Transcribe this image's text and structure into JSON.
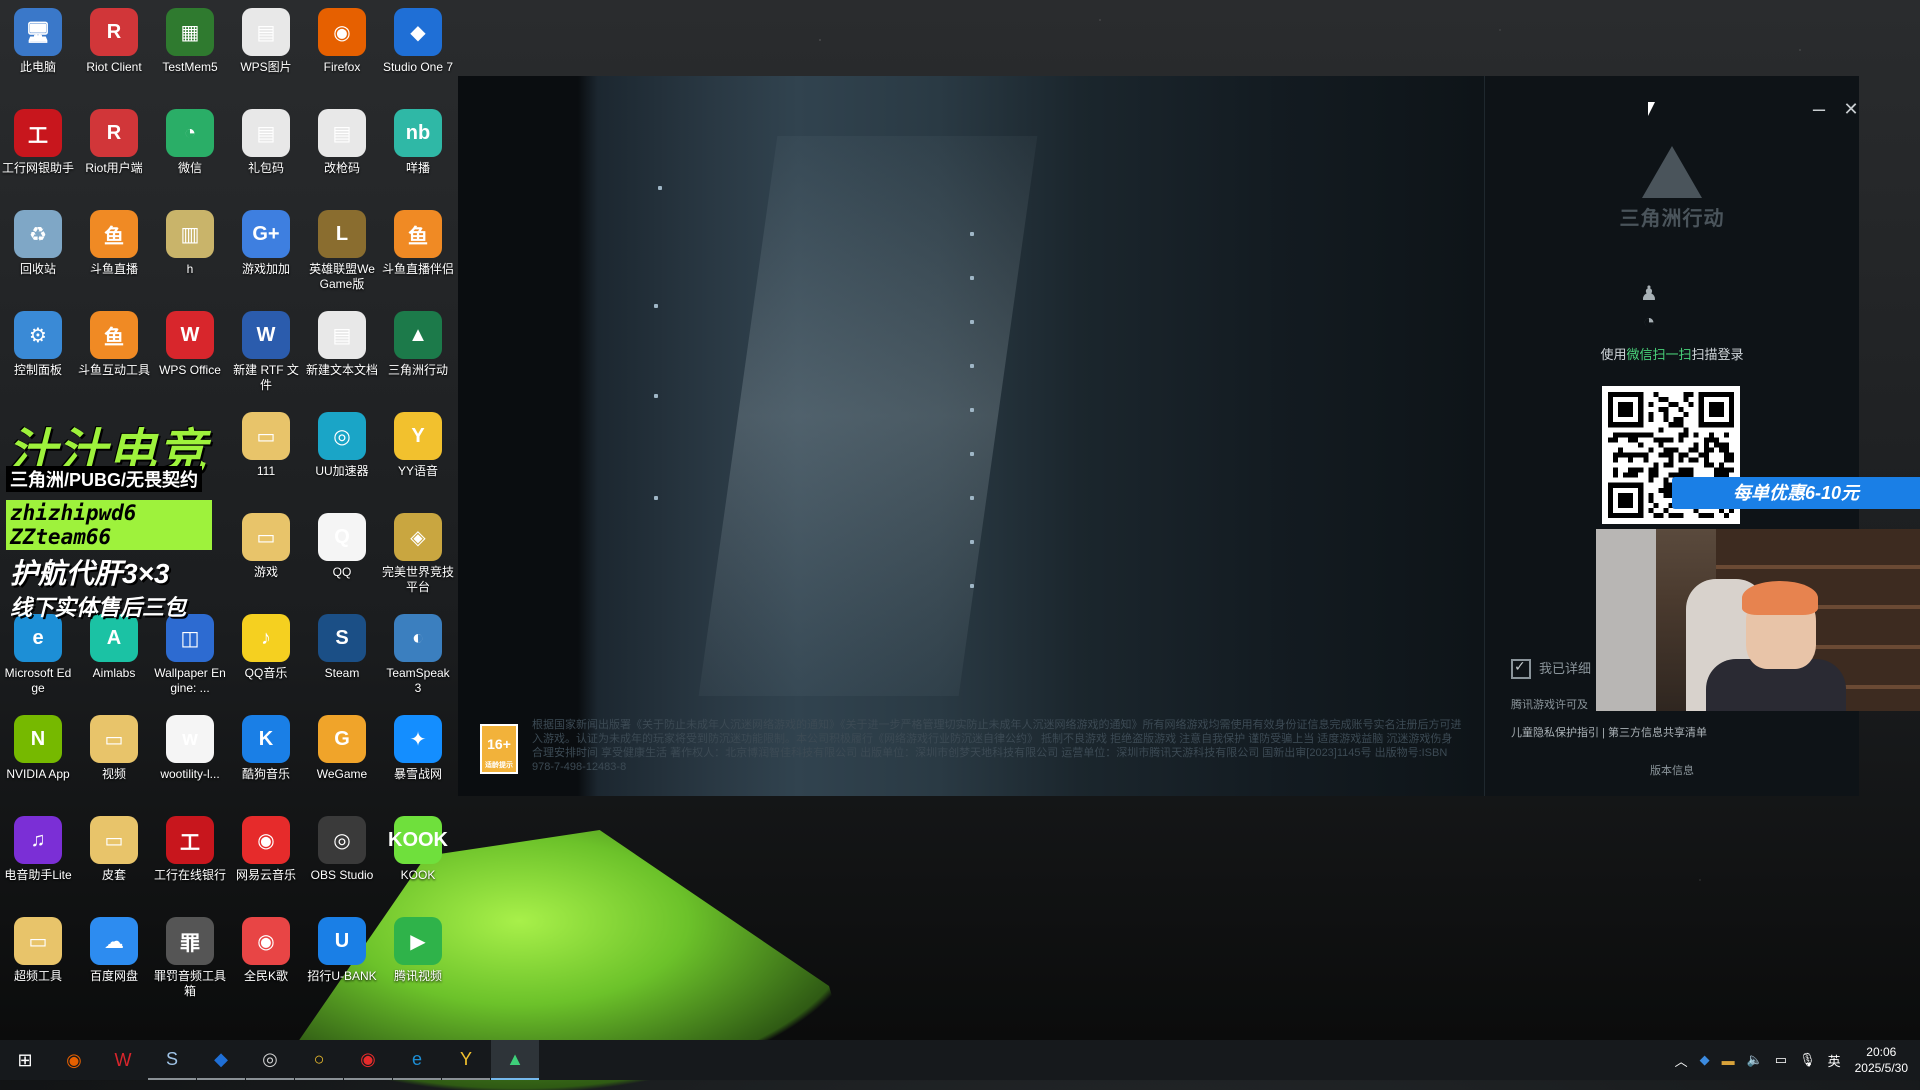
{
  "desktop_icons": [
    {
      "label": "此电脑",
      "glyph": "🖥",
      "color": "#3a78c9"
    },
    {
      "label": "Riot Client",
      "glyph": "R",
      "color": "#d13639"
    },
    {
      "label": "TestMem5",
      "glyph": "▦",
      "color": "#2f7a2f"
    },
    {
      "label": "WPS图片",
      "glyph": "▤",
      "color": "#e8e8e8"
    },
    {
      "label": "Firefox",
      "glyph": "◉",
      "color": "#e66000"
    },
    {
      "label": "Studio One 7",
      "glyph": "◆",
      "color": "#1f6fd6"
    },
    {
      "label": "工行网银助手",
      "glyph": "工",
      "color": "#c8161d"
    },
    {
      "label": "Riot用户端",
      "glyph": "R",
      "color": "#d13639"
    },
    {
      "label": "微信",
      "glyph": "◔",
      "color": "#2aae67"
    },
    {
      "label": "礼包码",
      "glyph": "▤",
      "color": "#e8e8e8"
    },
    {
      "label": "改枪码",
      "glyph": "▤",
      "color": "#e8e8e8"
    },
    {
      "label": "咩播",
      "glyph": "nb",
      "color": "#2fb8a6"
    },
    {
      "label": "回收站",
      "glyph": "♻",
      "color": "#7fa7c6"
    },
    {
      "label": "斗鱼直播",
      "glyph": "鱼",
      "color": "#f08a24"
    },
    {
      "label": "h",
      "glyph": "▥",
      "color": "#c9b46a"
    },
    {
      "label": "游戏加加",
      "glyph": "G+",
      "color": "#3e7fe0"
    },
    {
      "label": "英雄联盟WeGame版",
      "glyph": "L",
      "color": "#8a6d2f"
    },
    {
      "label": "斗鱼直播伴侣",
      "glyph": "鱼",
      "color": "#f08a24"
    },
    {
      "label": "控制面板",
      "glyph": "⚙",
      "color": "#3a8ad6"
    },
    {
      "label": "斗鱼互动工具",
      "glyph": "鱼",
      "color": "#f08a24"
    },
    {
      "label": "WPS Office",
      "glyph": "W",
      "color": "#d8262c"
    },
    {
      "label": "新建 RTF 文件",
      "glyph": "W",
      "color": "#2b5cad"
    },
    {
      "label": "新建文本文档",
      "glyph": "▤",
      "color": "#e8e8e8"
    },
    {
      "label": "三角洲行动",
      "glyph": "▲",
      "color": "#1c7a4a"
    },
    {
      "label": "111",
      "glyph": "▭",
      "color": "#e8c46a"
    },
    {
      "label": "UU加速器",
      "glyph": "◎",
      "color": "#1aa5c7"
    },
    {
      "label": "YY语音",
      "glyph": "Y",
      "color": "#f2c12e"
    },
    {
      "label": "游戏",
      "glyph": "▭",
      "color": "#e8c46a"
    },
    {
      "label": "QQ",
      "glyph": "Q",
      "color": "#f5f5f5"
    },
    {
      "label": "完美世界竞技平台",
      "glyph": "◈",
      "color": "#c9a640"
    },
    {
      "label": "Microsoft Edge",
      "glyph": "e",
      "color": "#1d8fd6"
    },
    {
      "label": "Aimlabs",
      "glyph": "A",
      "color": "#1bc2a4"
    },
    {
      "label": "Wallpaper Engine: ...",
      "glyph": "◫",
      "color": "#2d6bd1"
    },
    {
      "label": "QQ音乐",
      "glyph": "♪",
      "color": "#f5d020"
    },
    {
      "label": "Steam",
      "glyph": "S",
      "color": "#1b4f86"
    },
    {
      "label": "TeamSpeak 3",
      "glyph": "◐",
      "color": "#3b7fbf"
    },
    {
      "label": "NVIDIA App",
      "glyph": "N",
      "color": "#76b900"
    },
    {
      "label": "视频",
      "glyph": "▭",
      "color": "#e8c46a"
    },
    {
      "label": "wootility-l...",
      "glyph": "w",
      "color": "#f5f5f5"
    },
    {
      "label": "酷狗音乐",
      "glyph": "K",
      "color": "#1a7fe6"
    },
    {
      "label": "WeGame",
      "glyph": "G",
      "color": "#f0a42a"
    },
    {
      "label": "暴雪战网",
      "glyph": "✦",
      "color": "#148eff"
    },
    {
      "label": "电音助手Lite",
      "glyph": "♫",
      "color": "#7b2fd6"
    },
    {
      "label": "皮套",
      "glyph": "▭",
      "color": "#e8c46a"
    },
    {
      "label": "工行在线银行",
      "glyph": "工",
      "color": "#c8161d"
    },
    {
      "label": "网易云音乐",
      "glyph": "◉",
      "color": "#e62b2b"
    },
    {
      "label": "OBS Studio",
      "glyph": "◎",
      "color": "#3a3a3a"
    },
    {
      "label": "KOOK",
      "glyph": "KOOK",
      "color": "#6fe03c"
    },
    {
      "label": "超频工具",
      "glyph": "▭",
      "color": "#e8c46a"
    },
    {
      "label": "百度网盘",
      "glyph": "☁",
      "color": "#2d8cf0"
    },
    {
      "label": "罪罚音频工具箱",
      "glyph": "罪",
      "color": "#555555"
    },
    {
      "label": "全民K歌",
      "glyph": "◉",
      "color": "#e84545"
    },
    {
      "label": "招行U-BANK",
      "glyph": "U",
      "color": "#1a7fe6"
    },
    {
      "label": "腾讯视频",
      "glyph": "▶",
      "color": "#2fb34a"
    }
  ],
  "promo": {
    "title": "汁汁电竞",
    "line2": "三角洲/PUBG/无畏契约",
    "wechat": "zhizhipwd6\nZZteam66",
    "line4": "护航代肝3×3",
    "line5": "线下实体售后三包"
  },
  "launcher": {
    "age_rating": "16+",
    "age_rating_sub": "适龄提示",
    "notice": "根据国家新闻出版署《关于防止未成年人沉迷网络游戏的通知》《关于进一步严格管理切实防止未成年人沉迷网络游戏的通知》所有网络游戏均需使用有效身份证信息完成账号实名注册后方可进入游戏。认证为未成年的玩家将受到防沉迷功能限制。本公司积极履行《网络游戏行业防沉迷自律公约》 抵制不良游戏 拒绝盗版游戏 注意自我保护 谨防受骗上当 适度游戏益脑 沉迷游戏伤身 合理安排时间 享受健康生活 著作权人：北京博润智佳科技有限公司 出版单位：深圳市创梦天地科技有限公司 运营单位：深圳市腾讯天游科技有限公司 国新出审[2023]1145号 出版物号:ISBN 978-7-498-12483-8",
    "logo_text": "三角洲行动",
    "scan_prefix": "使用",
    "scan_highlight": "微信扫一扫",
    "scan_suffix": "扫描登录",
    "agree_text": "我已详细",
    "license_text": "腾讯游戏许可及",
    "privacy_links": "儿童隐私保护指引 | 第三方信息共享清单",
    "version_link": "版本信息",
    "minimize": "–",
    "close": "✕"
  },
  "overlay": {
    "discount": "每单优惠6-10元"
  },
  "taskbar": {
    "items": [
      {
        "name": "start",
        "glyph": "⊞",
        "color": "#ffffff"
      },
      {
        "name": "firefox",
        "glyph": "◉",
        "color": "#e66000"
      },
      {
        "name": "wps",
        "glyph": "W",
        "color": "#d8262c"
      },
      {
        "name": "steam",
        "glyph": "S",
        "color": "#9fc3e6"
      },
      {
        "name": "studio-one",
        "glyph": "◆",
        "color": "#1f6fd6"
      },
      {
        "name": "obs",
        "glyph": "◎",
        "color": "#cfcfcf"
      },
      {
        "name": "yy",
        "glyph": "○",
        "color": "#f2c12e"
      },
      {
        "name": "netease-music",
        "glyph": "◉",
        "color": "#e62b2b"
      },
      {
        "name": "edge",
        "glyph": "e",
        "color": "#1d8fd6"
      },
      {
        "name": "yy-voice",
        "glyph": "Y",
        "color": "#f2c12e"
      },
      {
        "name": "delta-force",
        "glyph": "▲",
        "color": "#3ed07a"
      }
    ],
    "tray_input": "英",
    "time": "20:06",
    "date": "2025/5/30"
  }
}
